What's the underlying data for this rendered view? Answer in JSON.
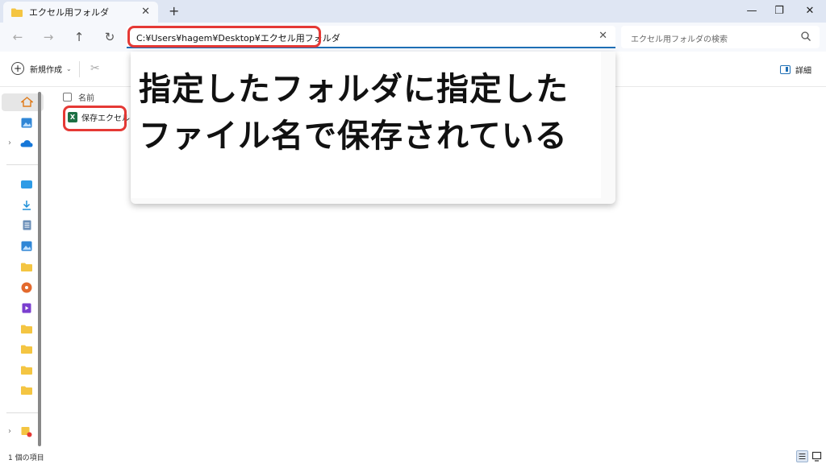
{
  "window": {
    "tab_title": "エクセル用フォルダ",
    "tab_close": "✕",
    "new_tab": "+",
    "minimize": "—",
    "restore": "❐",
    "close": "✕"
  },
  "nav": {
    "back": "←",
    "forward": "→",
    "up": "↑",
    "refresh": "↻",
    "address": "C:¥Users¥hagem¥Desktop¥エクセル用フォルダ",
    "address_clear": "✕",
    "search_placeholder": "エクセル用フォルダの検索"
  },
  "toolbar": {
    "new_label": "新規作成",
    "new_plus": "+",
    "new_caret": "⌄",
    "cut_icon": "✂",
    "details_label": "詳細"
  },
  "list": {
    "column_name": "名前",
    "files": [
      {
        "name": "保存エクセル",
        "icon": "excel-file-icon",
        "icon_letter": "X"
      }
    ]
  },
  "overlay": {
    "line1": "指定したフォルダに指定した",
    "line2": "ファイル名で保存されている"
  },
  "status": {
    "item_count": "1 個の項目"
  },
  "colors": {
    "highlight": "#e53935",
    "accent": "#1f6fb5",
    "excel": "#1d7044"
  }
}
